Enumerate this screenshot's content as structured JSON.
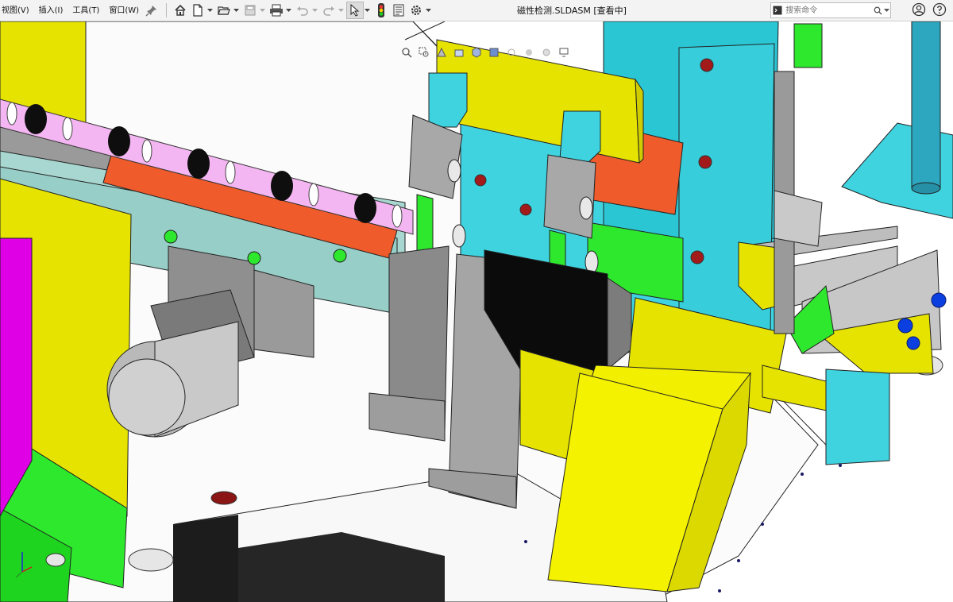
{
  "menu": {
    "items": [
      "视图(V)",
      "插入(I)",
      "工具(T)",
      "窗口(W)"
    ]
  },
  "window": {
    "title": "磁性检测.SLDASM [查看中]"
  },
  "search": {
    "placeholder": "搜索命令"
  },
  "icons": {
    "pin": "pin-icon",
    "home": "home-icon",
    "new": "new-document-icon",
    "open": "open-folder-icon",
    "save": "save-icon",
    "print": "print-icon",
    "undo": "undo-icon",
    "redo": "redo-icon",
    "select": "select-cursor-icon",
    "rebuild": "rebuild-traffic-light-icon",
    "file_props": "file-properties-icon",
    "options": "options-gear-icon",
    "search": "magnifier-icon",
    "help_dd": "chevron-down-icon",
    "account": "account-icon",
    "help": "help-icon"
  },
  "colors": {
    "yellow": "#e8e600",
    "cyan": "#3fd3e0",
    "orange_red": "#ef5b2a",
    "green": "#2ee82e",
    "magenta": "#e000e6",
    "grey_metal": "#8e8e8e",
    "plate_white": "#f7f7f7",
    "black": "#0b0b0b"
  }
}
